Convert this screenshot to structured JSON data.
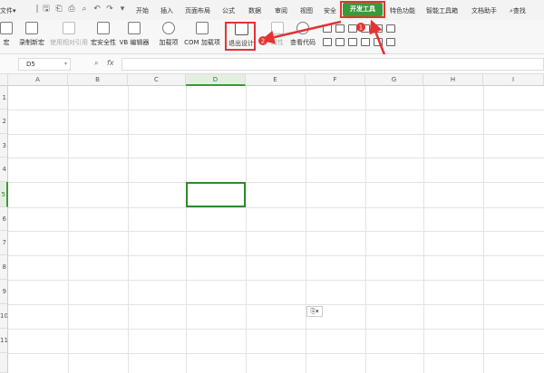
{
  "menu": {
    "file": "文件",
    "chevron": "▾",
    "tabs": [
      "开始",
      "插入",
      "页面布局",
      "公式",
      "数据",
      "审阅",
      "视图",
      "安全",
      "开发工具",
      "特色功能",
      "智能工具箱",
      "文档助手"
    ],
    "active_tab": "开发工具",
    "search": "查找"
  },
  "ribbon": {
    "buttons": [
      {
        "label": "宏"
      },
      {
        "label": "录制新宏"
      },
      {
        "label": "使用相对引用"
      },
      {
        "label": "宏安全性"
      },
      {
        "label": "VB 编辑器"
      },
      {
        "label": "加载项"
      },
      {
        "label": "COM 加载项"
      },
      {
        "label": "退出设计"
      },
      {
        "label": "属性"
      },
      {
        "label": "查看代码"
      }
    ]
  },
  "annotations": {
    "badge1": "1",
    "badge2": "2"
  },
  "formula_bar": {
    "name_box": "D5",
    "fx": "fx",
    "zoom_icon": "magnifier-icon"
  },
  "grid": {
    "columns": [
      "A",
      "B",
      "C",
      "D",
      "E",
      "F",
      "G",
      "H",
      "I"
    ],
    "rows": [
      "1",
      "2",
      "3",
      "4",
      "5",
      "6",
      "7",
      "8",
      "9",
      "10",
      "11"
    ],
    "selected_cell": "D5",
    "selected_column": "D",
    "selected_row": "5",
    "accent": "#3a9a3a",
    "highlight": "#e23434"
  }
}
